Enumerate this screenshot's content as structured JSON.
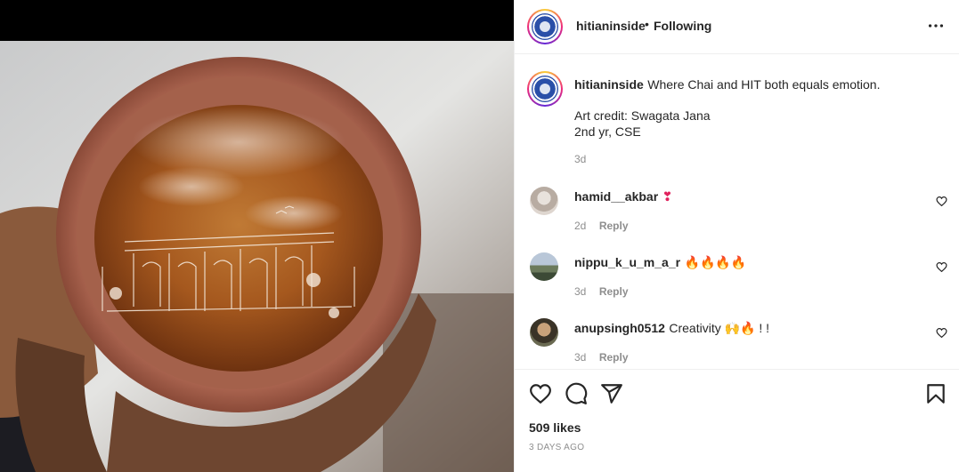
{
  "post": {
    "username": "hitianinside",
    "follow_state": "Following",
    "separator": "•",
    "more_icon": "more-horizontal-icon"
  },
  "caption": {
    "username": "hitianinside",
    "text": "Where Chai and HIT both equals emotion.",
    "credit_line1": "Art credit: Swagata Jana",
    "credit_line2": "2nd yr, CSE",
    "age": "3d"
  },
  "comments": [
    {
      "username": "hamid__akbar",
      "text": "❣",
      "age": "2d",
      "reply_label": "Reply"
    },
    {
      "username": "nippu_k_u_m_a_r",
      "text": "🔥🔥🔥🔥",
      "age": "3d",
      "reply_label": "Reply"
    },
    {
      "username": "anupsingh0512",
      "text": "Creativity 🙌🔥 ! !",
      "age": "3d",
      "reply_label": "Reply"
    }
  ],
  "actions": {
    "like_icon": "heart-icon",
    "comment_icon": "comment-icon",
    "share_icon": "send-icon",
    "save_icon": "bookmark-icon"
  },
  "likes": "509 likes",
  "posted": "3 DAYS AGO",
  "colors": {
    "text": "#262626",
    "secondary": "#8e8e8e",
    "border": "#efefef",
    "heart_emoji": "#e0245e",
    "fire_emoji": "#f57c00"
  }
}
